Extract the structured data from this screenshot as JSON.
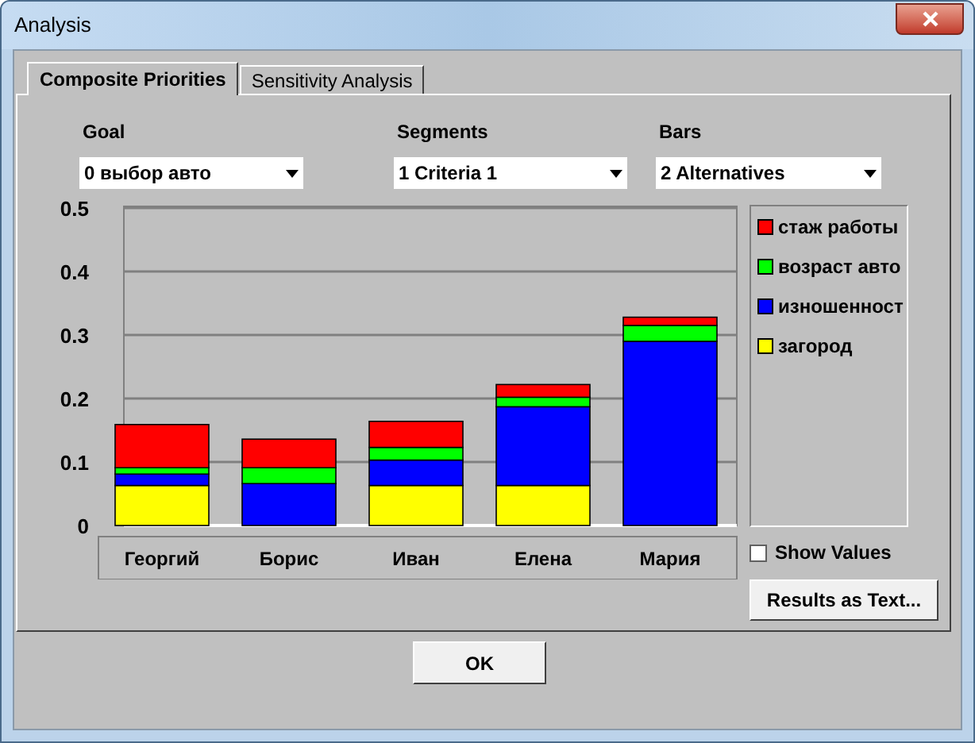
{
  "window": {
    "title": "Analysis"
  },
  "tabs": [
    {
      "label": "Composite Priorities",
      "selected": true
    },
    {
      "label": "Sensitivity Analysis",
      "selected": false
    }
  ],
  "selectors": [
    {
      "label": "Goal",
      "value": "0 выбор авто"
    },
    {
      "label": "Segments",
      "value": "1 Criteria 1"
    },
    {
      "label": "Bars",
      "value": "2 Alternatives"
    }
  ],
  "chart": {
    "chart_data": {
      "type": "bar",
      "stacked": true,
      "grid": true,
      "categories": [
        "Георгий",
        "Борис",
        "Иван",
        "Елена",
        "Мария"
      ],
      "ylim": [
        0,
        0.5
      ],
      "yticks": [
        {
          "value": 0,
          "label": "0"
        },
        {
          "value": 0.1,
          "label": "0.1"
        },
        {
          "value": 0.2,
          "label": "0.2"
        },
        {
          "value": 0.3,
          "label": "0.3"
        },
        {
          "value": 0.4,
          "label": "0.4"
        },
        {
          "value": 0.5,
          "label": "0.5"
        }
      ],
      "series": [
        {
          "name": "стаж работы",
          "color": "#ff0000",
          "values": [
            0.068,
            0.045,
            0.041,
            0.02,
            0.013
          ]
        },
        {
          "name": "возраст авто",
          "color": "#00ff00",
          "values": [
            0.01,
            0.025,
            0.02,
            0.015,
            0.025
          ]
        },
        {
          "name": "изношенност",
          "color": "#0000ff",
          "values": [
            0.018,
            0.066,
            0.04,
            0.124,
            0.29
          ]
        },
        {
          "name": "загород",
          "color": "#ffff00",
          "values": [
            0.063,
            0,
            0.063,
            0.063,
            0
          ]
        }
      ]
    }
  },
  "show_values": {
    "label": "Show Values",
    "checked": false
  },
  "buttons": {
    "results": "Results as Text...",
    "ok": "OK"
  }
}
